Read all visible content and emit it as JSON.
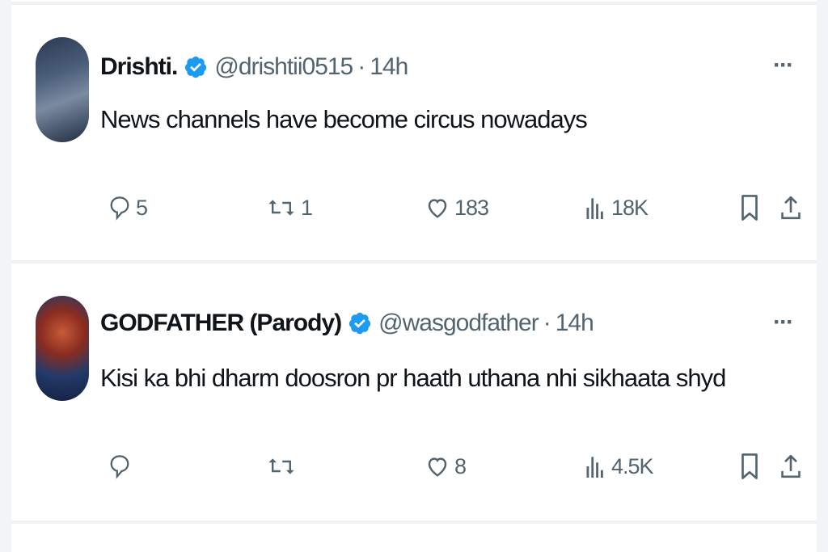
{
  "tweets": [
    {
      "name": "Drishti.",
      "handle": "@drishtii0515",
      "separator": "·",
      "time": "14h",
      "text": "News channels have become circus nowadays",
      "more": "···",
      "replies": "5",
      "reposts": "1",
      "likes": "183",
      "views": "18K",
      "verified_color": "#1d9bf0"
    },
    {
      "name": "GODFATHER (Parody)",
      "handle": "@wasgodfather",
      "separator": "·",
      "time": "14h",
      "text": "Kisi ka bhi dharm doosron pr haath uthana nhi sikhaata shyd",
      "more": "···",
      "replies": "",
      "reposts": "",
      "likes": "8",
      "views": "4.5K",
      "verified_color": "#1d9bf0"
    }
  ],
  "icons": [
    "reply-icon",
    "repost-icon",
    "like-icon",
    "views-icon",
    "bookmark-icon",
    "share-icon",
    "more-icon",
    "verified-badge-icon"
  ],
  "colors": {
    "text_primary": "#0f1419",
    "text_secondary": "#536471",
    "verified": "#1d9bf0",
    "divider": "#eff2f4"
  }
}
